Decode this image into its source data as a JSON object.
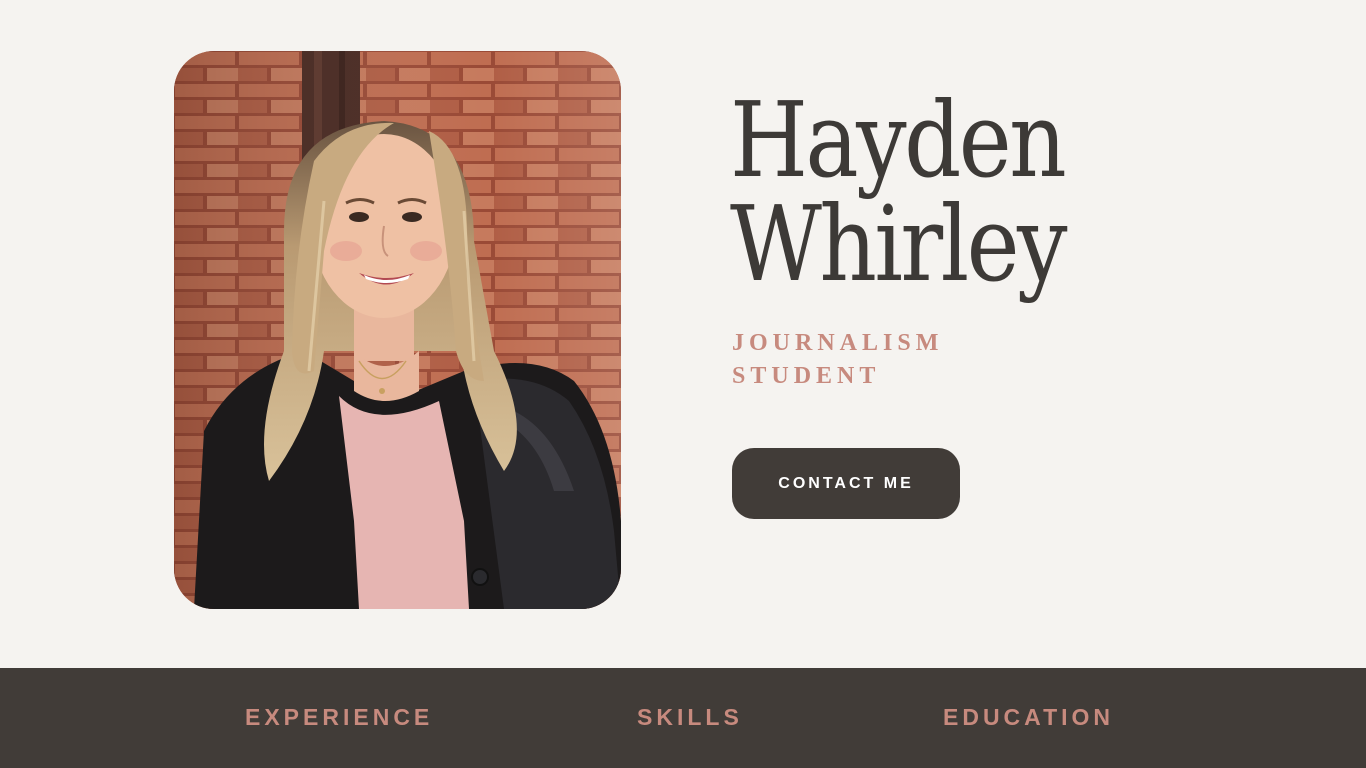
{
  "profile": {
    "first_name": "Hayden",
    "last_name": "Whirley",
    "role_line1": "JOURNALISM",
    "role_line2": "STUDENT",
    "photo_alt": "Hayden Whirley"
  },
  "cta": {
    "contact_label": "CONTACT ME"
  },
  "nav": {
    "items": [
      {
        "label": "EXPERIENCE"
      },
      {
        "label": "SKILLS"
      },
      {
        "label": "EDUCATION"
      }
    ]
  },
  "colors": {
    "background": "#f5f3f0",
    "dark": "#413c38",
    "accent": "#c78a7e",
    "name_text": "#3d3a37"
  }
}
